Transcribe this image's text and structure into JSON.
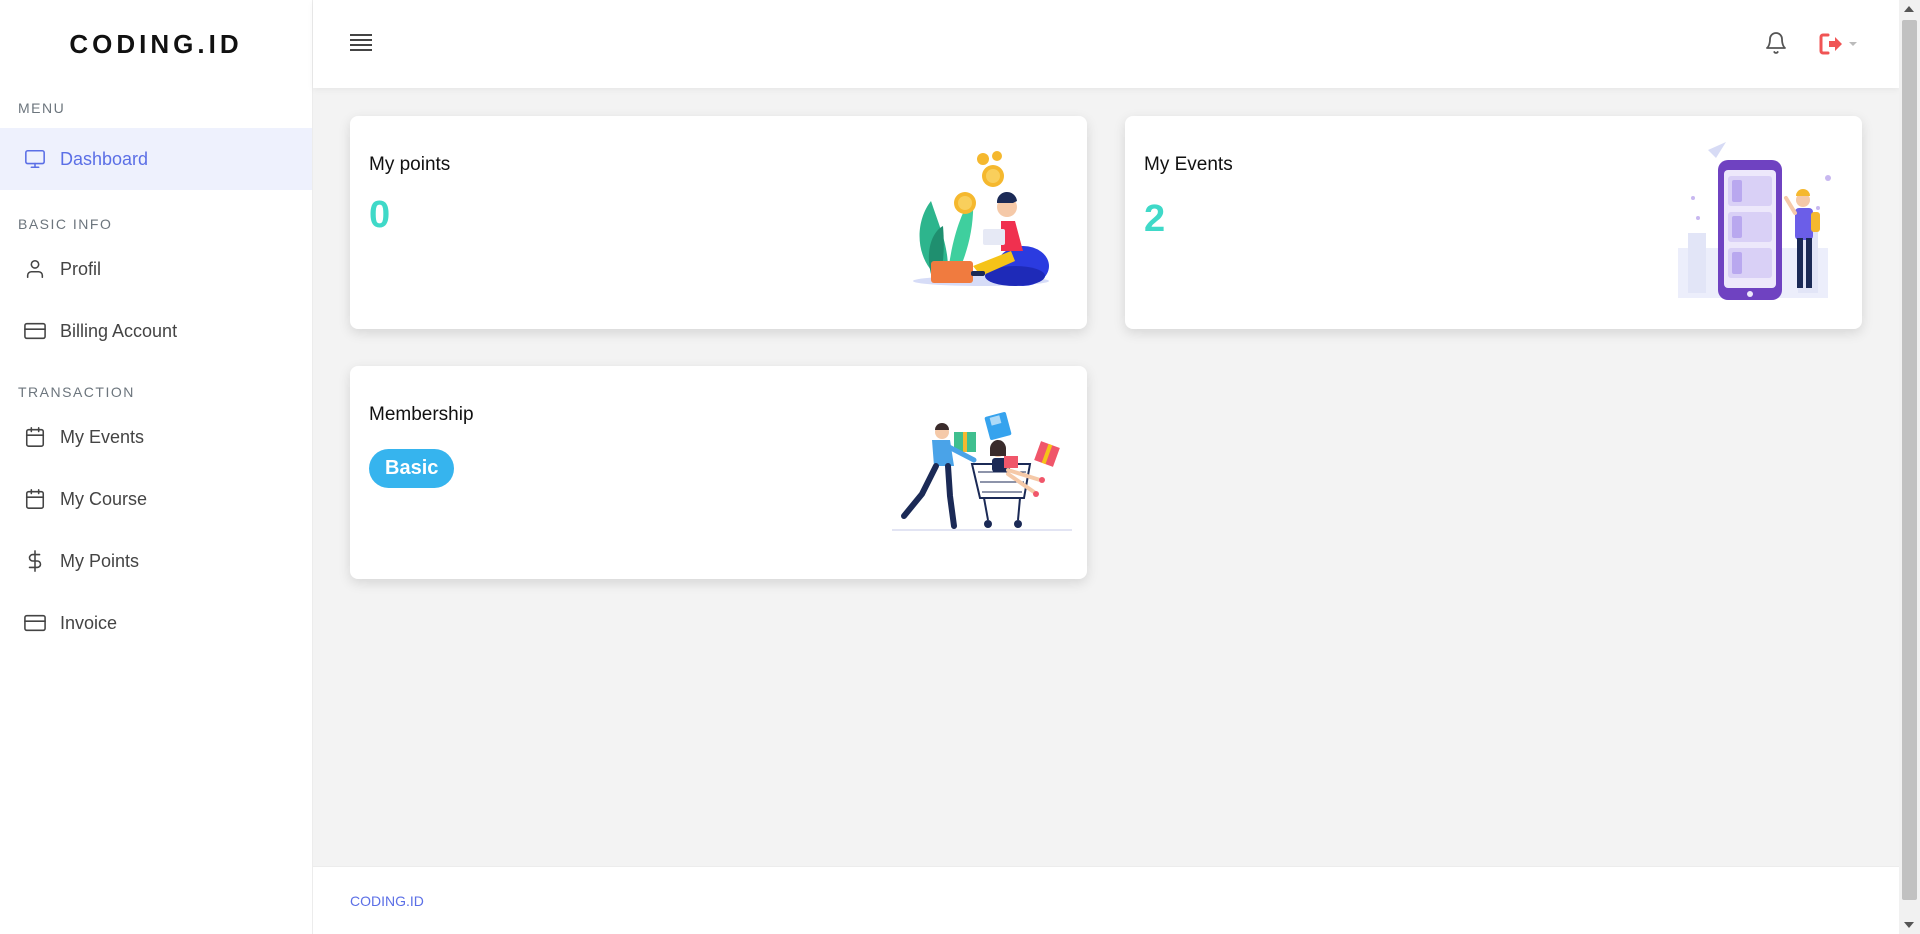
{
  "brand": "CODING.ID",
  "sidebar": {
    "sections": {
      "menu": "MENU",
      "basic_info": "BASIC INFO",
      "transaction": "TRANSACTION"
    },
    "items": [
      {
        "label": "Dashboard",
        "icon": "monitor-icon",
        "active": true
      },
      {
        "label": "Profil",
        "icon": "user-icon"
      },
      {
        "label": "Billing Account",
        "icon": "credit-card-icon"
      },
      {
        "label": "My Events",
        "icon": "calendar-icon"
      },
      {
        "label": "My Course",
        "icon": "calendar-icon"
      },
      {
        "label": "My Points",
        "icon": "dollar-icon"
      },
      {
        "label": "Invoice",
        "icon": "credit-card-icon"
      }
    ]
  },
  "header": {
    "menu_icon": "hamburger-icon",
    "notification_icon": "bell-icon",
    "logout_icon": "sign-out-icon"
  },
  "cards": {
    "points": {
      "title": "My points",
      "value": "0"
    },
    "events": {
      "title": "My Events",
      "value": "2"
    },
    "membership": {
      "title": "Membership",
      "badge": "Basic"
    }
  },
  "footer": {
    "text": "CODING.ID"
  },
  "colors": {
    "accent": "#5b6fe6",
    "active_bg": "#eef1fd",
    "value": "#3fd9c8",
    "badge": "#36b4ee",
    "logout": "#f05454"
  }
}
